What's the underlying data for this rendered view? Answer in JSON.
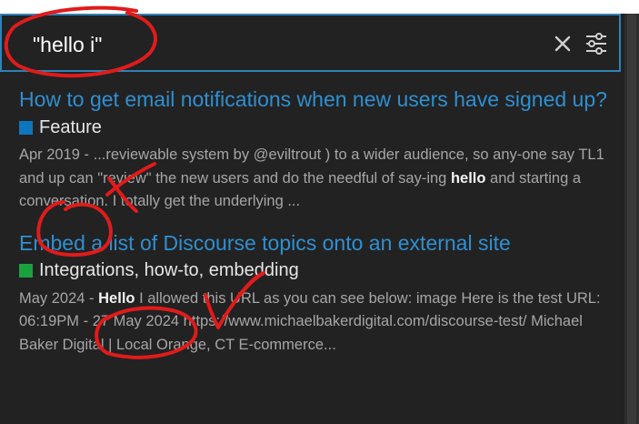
{
  "search": {
    "query": "\"hello i\"",
    "clear_icon": "close-icon",
    "filter_icon": "sliders-icon",
    "accent_color": "#2e83b7"
  },
  "results": [
    {
      "title": "How to get email notifications when new users have signed up?",
      "category": {
        "name": "Feature",
        "color": "#0e76bd"
      },
      "date": "Apr 2019",
      "blurb_pre": " - ...reviewable system by @eviltrout ) to a wider audience, so any-one say TL1 and up can \"review\" the new users and do the needful of say-ing ",
      "highlight": "hello",
      "blurb_post": " and starting a conversation. I totally get the underlying ..."
    },
    {
      "title": "Embed a list of Discourse topics onto an external site",
      "category": {
        "name": "Integrations, how-to, embedding",
        "color": "#1aa33d"
      },
      "date": "May 2024",
      "blurb_pre": " - ",
      "highlight": "Hello",
      "blurb_post": " I allowed this URL as you can see below: image Here is the test URL: 06:19PM - 27 May 2024 https://www.michaelbakerdigital.com/discourse-test/ Michael Baker Digital | Local Orange, CT E-commerce..."
    }
  ],
  "colors": {
    "panel_bg": "#222222",
    "link": "#2f8fd1",
    "annotation": "#e01b1b"
  }
}
